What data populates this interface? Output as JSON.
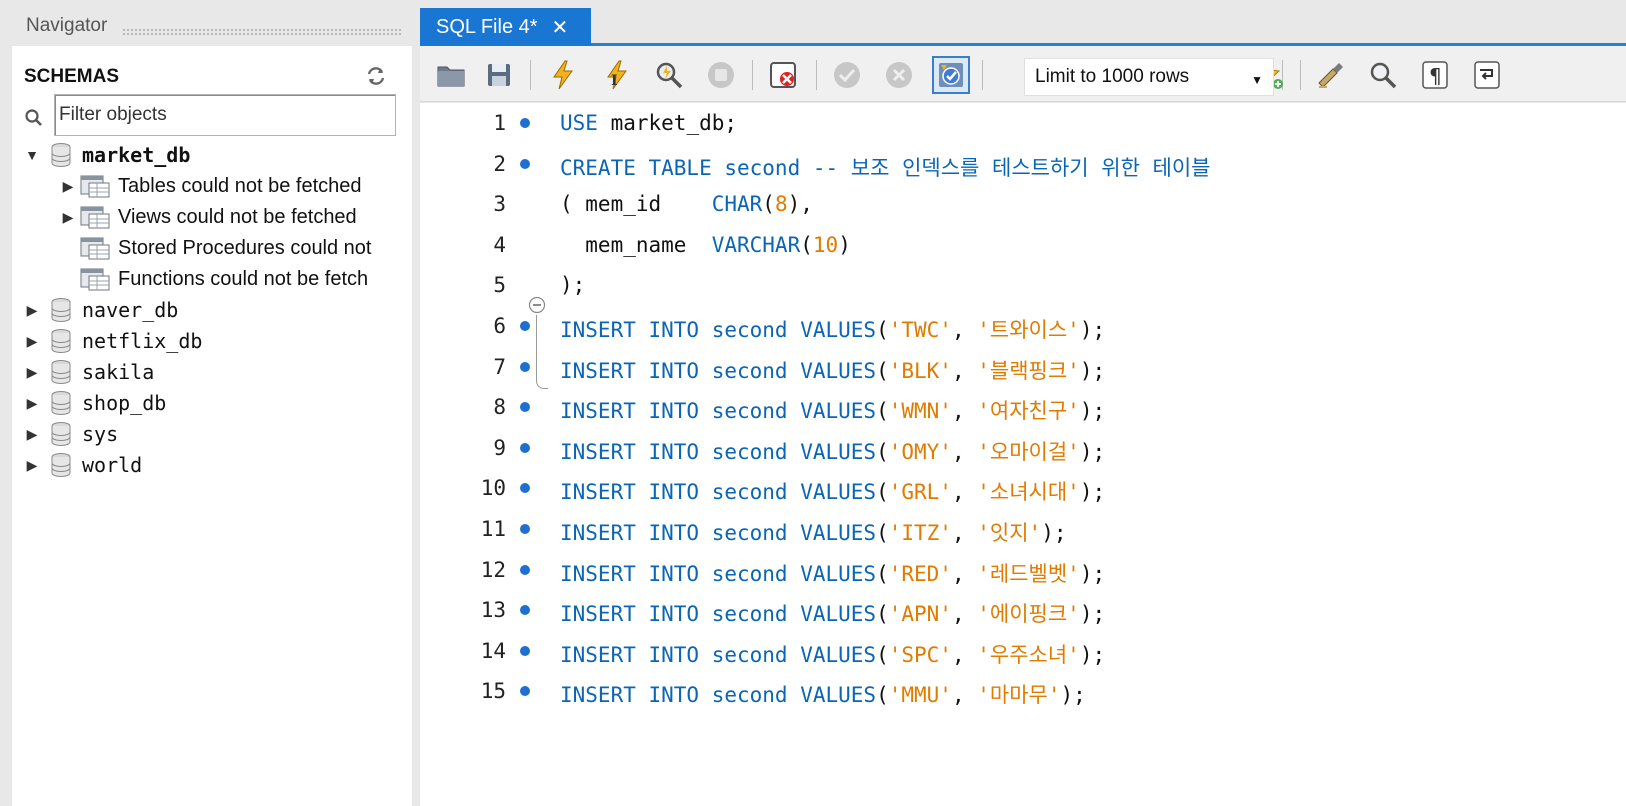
{
  "navigator": {
    "title": "Navigator",
    "schemas_label": "SCHEMAS",
    "filter_placeholder": "Filter objects",
    "schemas": [
      {
        "name": "market_db",
        "expanded": true,
        "children": [
          {
            "label": "Tables could not be fetched",
            "expandable": true
          },
          {
            "label": "Views could not be fetched",
            "expandable": true
          },
          {
            "label": "Stored Procedures could not",
            "expandable": false
          },
          {
            "label": "Functions could not be fetch",
            "expandable": false
          }
        ]
      },
      {
        "name": "naver_db",
        "expanded": false
      },
      {
        "name": "netflix_db",
        "expanded": false
      },
      {
        "name": "sakila",
        "expanded": false
      },
      {
        "name": "shop_db",
        "expanded": false
      },
      {
        "name": "sys",
        "expanded": false
      },
      {
        "name": "world",
        "expanded": false
      }
    ]
  },
  "editor": {
    "tab_label": "SQL File 4*",
    "limit_label": "Limit to 1000 rows",
    "toolbar_icons": [
      "open-file-icon",
      "save-icon",
      "execute-icon",
      "execute-current-icon",
      "explain-icon",
      "stop-icon",
      "toggle-error-icon",
      "commit-icon",
      "rollback-icon",
      "autocommit-icon",
      "bookmark-icon",
      "beautify-icon",
      "find-icon",
      "invisible-chars-icon",
      "word-wrap-icon"
    ],
    "lines": [
      {
        "n": "1",
        "dot": true,
        "tokens": [
          [
            "kw",
            "USE"
          ],
          [
            "p",
            " market_db;"
          ]
        ]
      },
      {
        "n": "2",
        "dot": true,
        "tokens": [
          [
            "kw",
            "CREATE TABLE second"
          ],
          [
            "p",
            " "
          ],
          [
            "cmt",
            "-- 보조 인덱스를 테스트하기 위한 테이블"
          ]
        ]
      },
      {
        "n": "3",
        "dot": false,
        "tokens": [
          [
            "p",
            "( mem_id    "
          ],
          [
            "kw",
            "CHAR"
          ],
          [
            "p",
            "("
          ],
          [
            "num",
            "8"
          ],
          [
            "p",
            "),"
          ]
        ]
      },
      {
        "n": "4",
        "dot": false,
        "tokens": [
          [
            "p",
            "  mem_name  "
          ],
          [
            "kw",
            "VARCHAR"
          ],
          [
            "p",
            "("
          ],
          [
            "num",
            "10"
          ],
          [
            "p",
            ")"
          ]
        ]
      },
      {
        "n": "5",
        "dot": false,
        "tokens": [
          [
            "p",
            ");"
          ]
        ]
      },
      {
        "n": "6",
        "dot": true,
        "tokens": [
          [
            "kw",
            "INSERT INTO second VALUES"
          ],
          [
            "p",
            "("
          ],
          [
            "str",
            "'TWC'"
          ],
          [
            "p",
            ", "
          ],
          [
            "str",
            "'트와이스'"
          ],
          [
            "p",
            ");"
          ]
        ]
      },
      {
        "n": "7",
        "dot": true,
        "tokens": [
          [
            "kw",
            "INSERT INTO second VALUES"
          ],
          [
            "p",
            "("
          ],
          [
            "str",
            "'BLK'"
          ],
          [
            "p",
            ", "
          ],
          [
            "str",
            "'블랙핑크'"
          ],
          [
            "p",
            ");"
          ]
        ]
      },
      {
        "n": "8",
        "dot": true,
        "tokens": [
          [
            "kw",
            "INSERT INTO second VALUES"
          ],
          [
            "p",
            "("
          ],
          [
            "str",
            "'WMN'"
          ],
          [
            "p",
            ", "
          ],
          [
            "str",
            "'여자친구'"
          ],
          [
            "p",
            ");"
          ]
        ]
      },
      {
        "n": "9",
        "dot": true,
        "tokens": [
          [
            "kw",
            "INSERT INTO second VALUES"
          ],
          [
            "p",
            "("
          ],
          [
            "str",
            "'OMY'"
          ],
          [
            "p",
            ", "
          ],
          [
            "str",
            "'오마이걸'"
          ],
          [
            "p",
            ");"
          ]
        ]
      },
      {
        "n": "10",
        "dot": true,
        "tokens": [
          [
            "kw",
            "INSERT INTO second VALUES"
          ],
          [
            "p",
            "("
          ],
          [
            "str",
            "'GRL'"
          ],
          [
            "p",
            ", "
          ],
          [
            "str",
            "'소녀시대'"
          ],
          [
            "p",
            ");"
          ]
        ]
      },
      {
        "n": "11",
        "dot": true,
        "tokens": [
          [
            "kw",
            "INSERT INTO second VALUES"
          ],
          [
            "p",
            "("
          ],
          [
            "str",
            "'ITZ'"
          ],
          [
            "p",
            ", "
          ],
          [
            "str",
            "'잇지'"
          ],
          [
            "p",
            ");"
          ]
        ]
      },
      {
        "n": "12",
        "dot": true,
        "tokens": [
          [
            "kw",
            "INSERT INTO second VALUES"
          ],
          [
            "p",
            "("
          ],
          [
            "str",
            "'RED'"
          ],
          [
            "p",
            ", "
          ],
          [
            "str",
            "'레드벨벳'"
          ],
          [
            "p",
            ");"
          ]
        ]
      },
      {
        "n": "13",
        "dot": true,
        "tokens": [
          [
            "kw",
            "INSERT INTO second VALUES"
          ],
          [
            "p",
            "("
          ],
          [
            "str",
            "'APN'"
          ],
          [
            "p",
            ", "
          ],
          [
            "str",
            "'에이핑크'"
          ],
          [
            "p",
            ");"
          ]
        ]
      },
      {
        "n": "14",
        "dot": true,
        "tokens": [
          [
            "kw",
            "INSERT INTO second VALUES"
          ],
          [
            "p",
            "("
          ],
          [
            "str",
            "'SPC'"
          ],
          [
            "p",
            ", "
          ],
          [
            "str",
            "'우주소녀'"
          ],
          [
            "p",
            ");"
          ]
        ]
      },
      {
        "n": "15",
        "dot": true,
        "tokens": [
          [
            "kw",
            "INSERT INTO second VALUES"
          ],
          [
            "p",
            "("
          ],
          [
            "str",
            "'MMU'"
          ],
          [
            "p",
            ", "
          ],
          [
            "str",
            "'마마무'"
          ],
          [
            "p",
            ");"
          ]
        ]
      }
    ]
  },
  "colors": {
    "keyword": "#0b65b5",
    "string": "#e07b00",
    "tab_active": "#1976d2",
    "statement_dot": "#1f6fd0"
  }
}
